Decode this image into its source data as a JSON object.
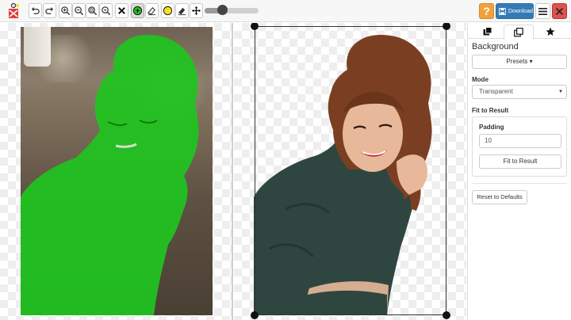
{
  "toolbar": {
    "icons": [
      "undo-icon",
      "redo-icon",
      "zoom-in-icon",
      "zoom-out-icon",
      "zoom-fit-icon",
      "zoom-actual-icon",
      "clear-icon",
      "keep-brush-icon",
      "remove-brush-icon",
      "hair-brush-icon",
      "eraser-icon",
      "move-icon"
    ],
    "brush_size_fraction": 0.33,
    "help_label": "?",
    "download_label": "Download"
  },
  "colors": {
    "keep_mask": "#1fc41f",
    "help": "#f0a23a",
    "download": "#337ab7",
    "close": "#d9534f",
    "hair_brush": "#f2e024"
  },
  "side_panel": {
    "tabs": [
      "layers-icon",
      "copy-icon",
      "star-icon"
    ],
    "active_tab": 1,
    "title": "Background",
    "presets_label": "Presets ▾",
    "mode_label": "Mode",
    "mode_value": "Transparent",
    "fit_label": "Fit to Result",
    "padding_label": "Padding",
    "padding_value": "10",
    "fit_button": "Fit to Result",
    "reset_button": "Reset to Defaults"
  }
}
